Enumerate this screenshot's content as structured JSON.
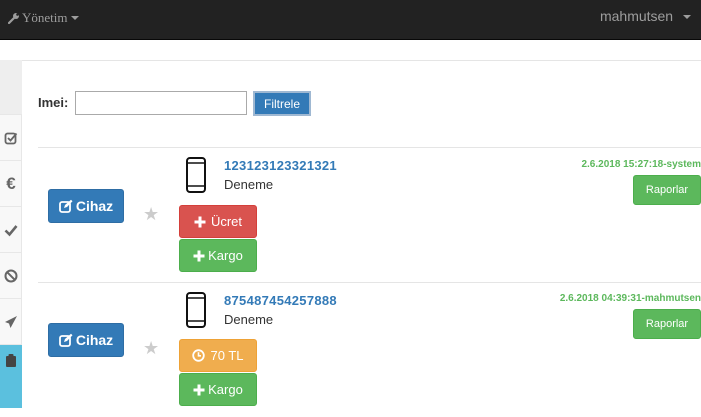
{
  "navbar": {
    "menu_label": "Yönetim",
    "user_label": "mahmutsen",
    "bg_color": "#222222"
  },
  "sidebar": {
    "items": [
      {
        "icon": "check-square-icon"
      },
      {
        "icon": "euro-icon"
      },
      {
        "icon": "check-icon"
      },
      {
        "icon": "ban-icon"
      },
      {
        "icon": "paper-plane-icon"
      },
      {
        "icon": "clipboard-icon",
        "active": true
      }
    ]
  },
  "filter": {
    "label": "Imei:",
    "input_value": "",
    "button_label": "Filtrele"
  },
  "devices": [
    {
      "cihaz_label": "Cihaz",
      "imei": "123123123321321",
      "description": "Deneme",
      "fee_label": "Ücret",
      "kargo_label": "Kargo",
      "timestamp": "2.6.2018 15:27:18-system",
      "report_label": "Raporlar"
    },
    {
      "cihaz_label": "Cihaz",
      "imei": "875487454257888",
      "description": "Deneme",
      "fee_label": "70 TL",
      "kargo_label": "Kargo",
      "timestamp": "2.6.2018 04:39:31-mahmutsen",
      "report_label": "Raporlar"
    }
  ],
  "colors": {
    "primary": "#337ab7",
    "danger": "#d9534f",
    "success": "#5cb85c",
    "warning": "#f0ad4e",
    "sidebar_active": "#5bc0de"
  }
}
